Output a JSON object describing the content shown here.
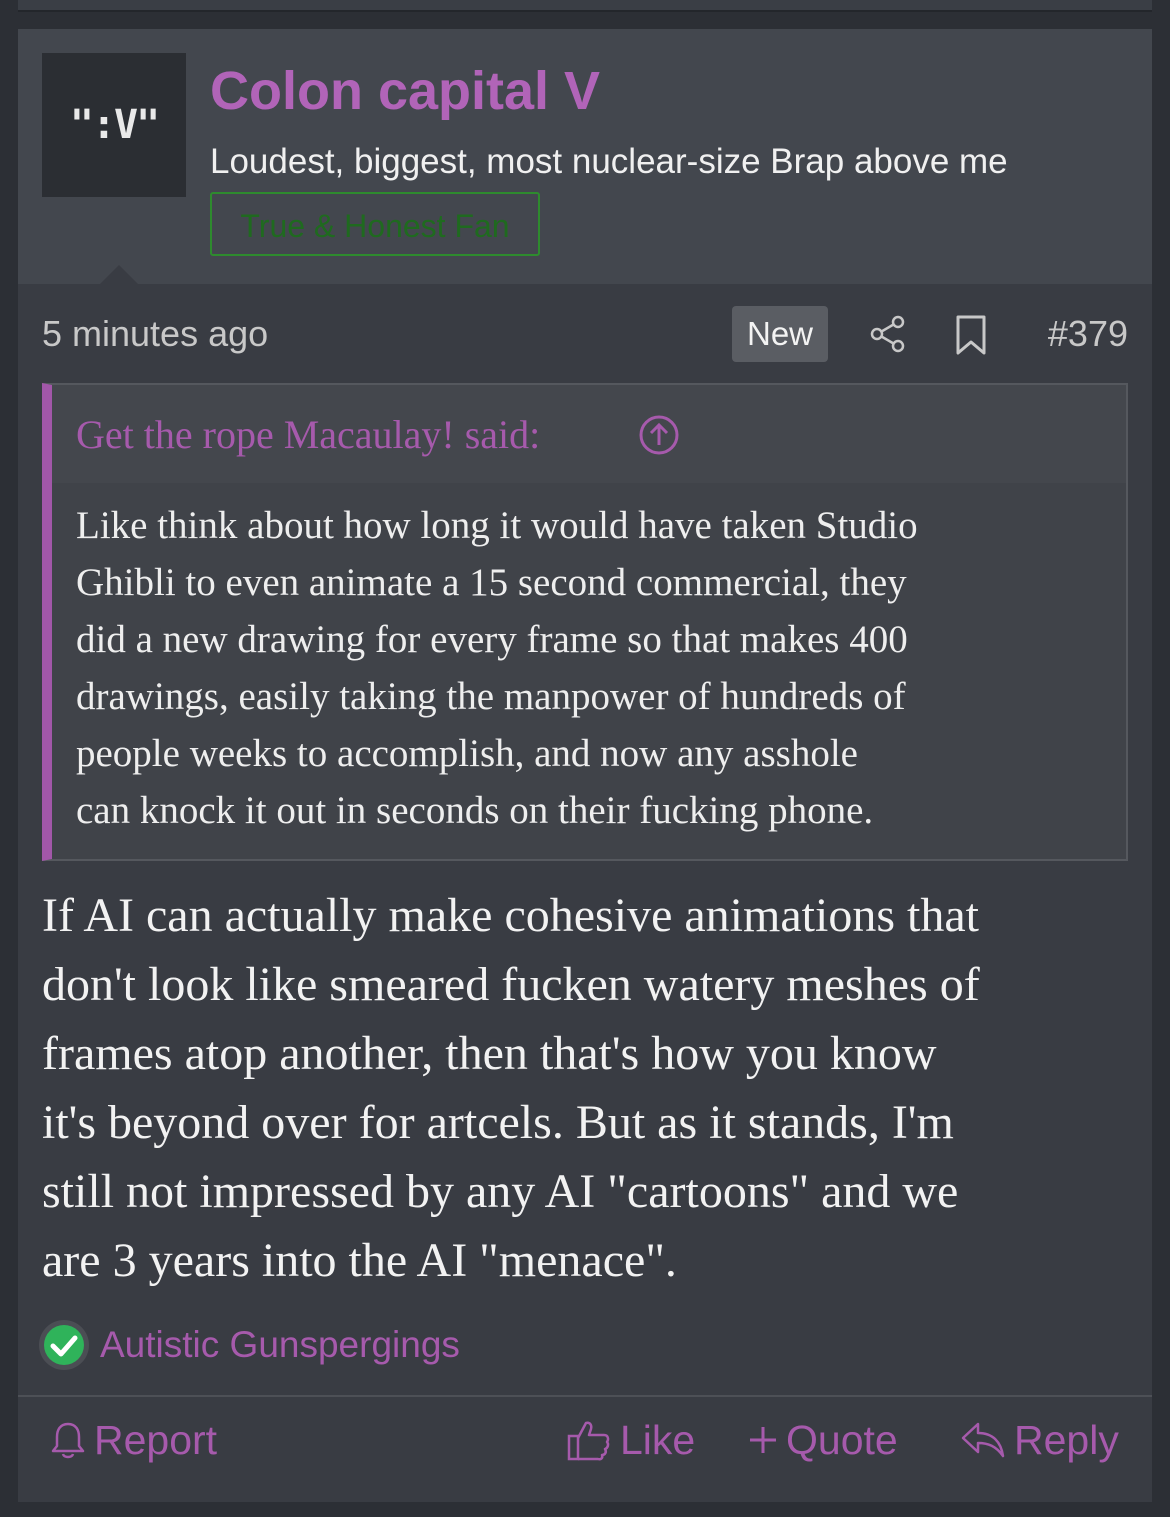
{
  "post": {
    "avatar_text": "\":V\"",
    "username": "Colon capital V",
    "user_title": "Loudest, biggest, most nuclear-size Brap above me",
    "user_banner": "True & Honest Fan",
    "time_ago": "5 minutes ago",
    "new_badge": "New",
    "post_number": "#379",
    "quote": {
      "author_line": "Get the rope Macaulay! said:",
      "lines": [
        "Like think about how long it would have taken Studio",
        "Ghibli to even animate a 15 second commercial, they",
        "did a new drawing for every frame so that makes 400",
        "drawings, easily taking the manpower of hundreds of",
        "people weeks to accomplish, and now any asshole",
        "can knock it out in seconds on their fucking phone."
      ]
    },
    "message_lines": [
      "If AI can actually make cohesive animations that",
      "don't look like smeared fucken watery meshes of",
      "frames atop another, then that's how you know",
      "it's beyond over for artcels. But as it stands, I'm",
      "still not impressed by any AI \"cartoons\" and we",
      "are 3 years into the AI \"menace\"."
    ],
    "reaction_label": "Autistic Gunspergings",
    "actions": {
      "report": "Report",
      "like": "Like",
      "quote": "Quote",
      "reply": "Reply"
    }
  },
  "colors": {
    "accent": "#a65aac",
    "username": "#b164b8",
    "banner_border": "#2e8b2e",
    "check_green": "#2fb35a"
  },
  "icons": [
    "share-icon",
    "bookmark-icon",
    "arrow-up-circle-icon",
    "check-circle-icon",
    "bell-icon",
    "thumbs-up-icon",
    "plus-icon",
    "reply-arrow-icon"
  ]
}
